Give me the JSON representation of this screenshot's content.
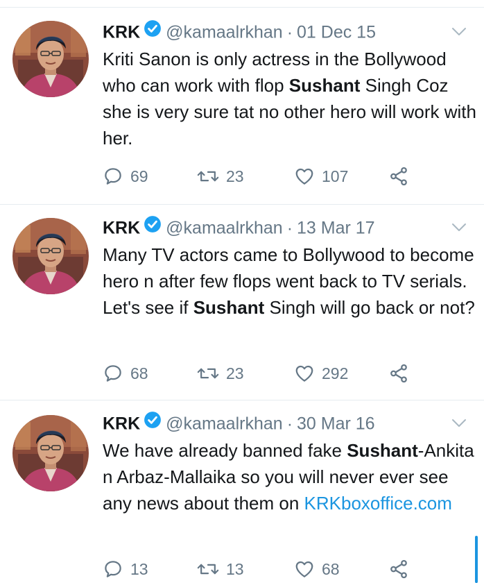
{
  "tweets": [
    {
      "name": "KRK",
      "handle": "@kamaalrkhan",
      "separator": "·",
      "date": "01 Dec 15",
      "text": {
        "part1": "Kriti Sanon is only actress in the Bollywood who can work with flop ",
        "bold": "Sushant",
        "part2": " Singh Coz she is very sure tat no other hero will work with her."
      },
      "replies": "69",
      "retweets": "23",
      "likes": "107"
    },
    {
      "name": "KRK",
      "handle": "@kamaalrkhan",
      "separator": "·",
      "date": "13 Mar 17",
      "text": {
        "part1": "Many TV actors came to Bollywood to become hero n after few flops went back to TV serials. Let's see if ",
        "bold": "Sushant",
        "part2": " Singh will go back or not?"
      },
      "replies": "68",
      "retweets": "23",
      "likes": "292"
    },
    {
      "name": "KRK",
      "handle": "@kamaalrkhan",
      "separator": "·",
      "date": "30 Mar 16",
      "text": {
        "part1": "We have already banned fake ",
        "bold": "Sushant",
        "part2": "-Ankita n Arbaz-Mallaika so you will never ever see any news about them on ",
        "link": "KRKboxoffice.com"
      },
      "replies": "13",
      "retweets": "13",
      "likes": "68"
    }
  ],
  "icons": {
    "verified": "verified-badge-icon",
    "menu": "chevron-down-icon",
    "reply": "reply-icon",
    "retweet": "retweet-icon",
    "like": "heart-icon",
    "share": "share-icon"
  },
  "colors": {
    "text": "#14171a",
    "secondary": "#657786",
    "link": "#1b95e0",
    "verified": "#1da1f2",
    "divider": "#e6ecf0"
  }
}
